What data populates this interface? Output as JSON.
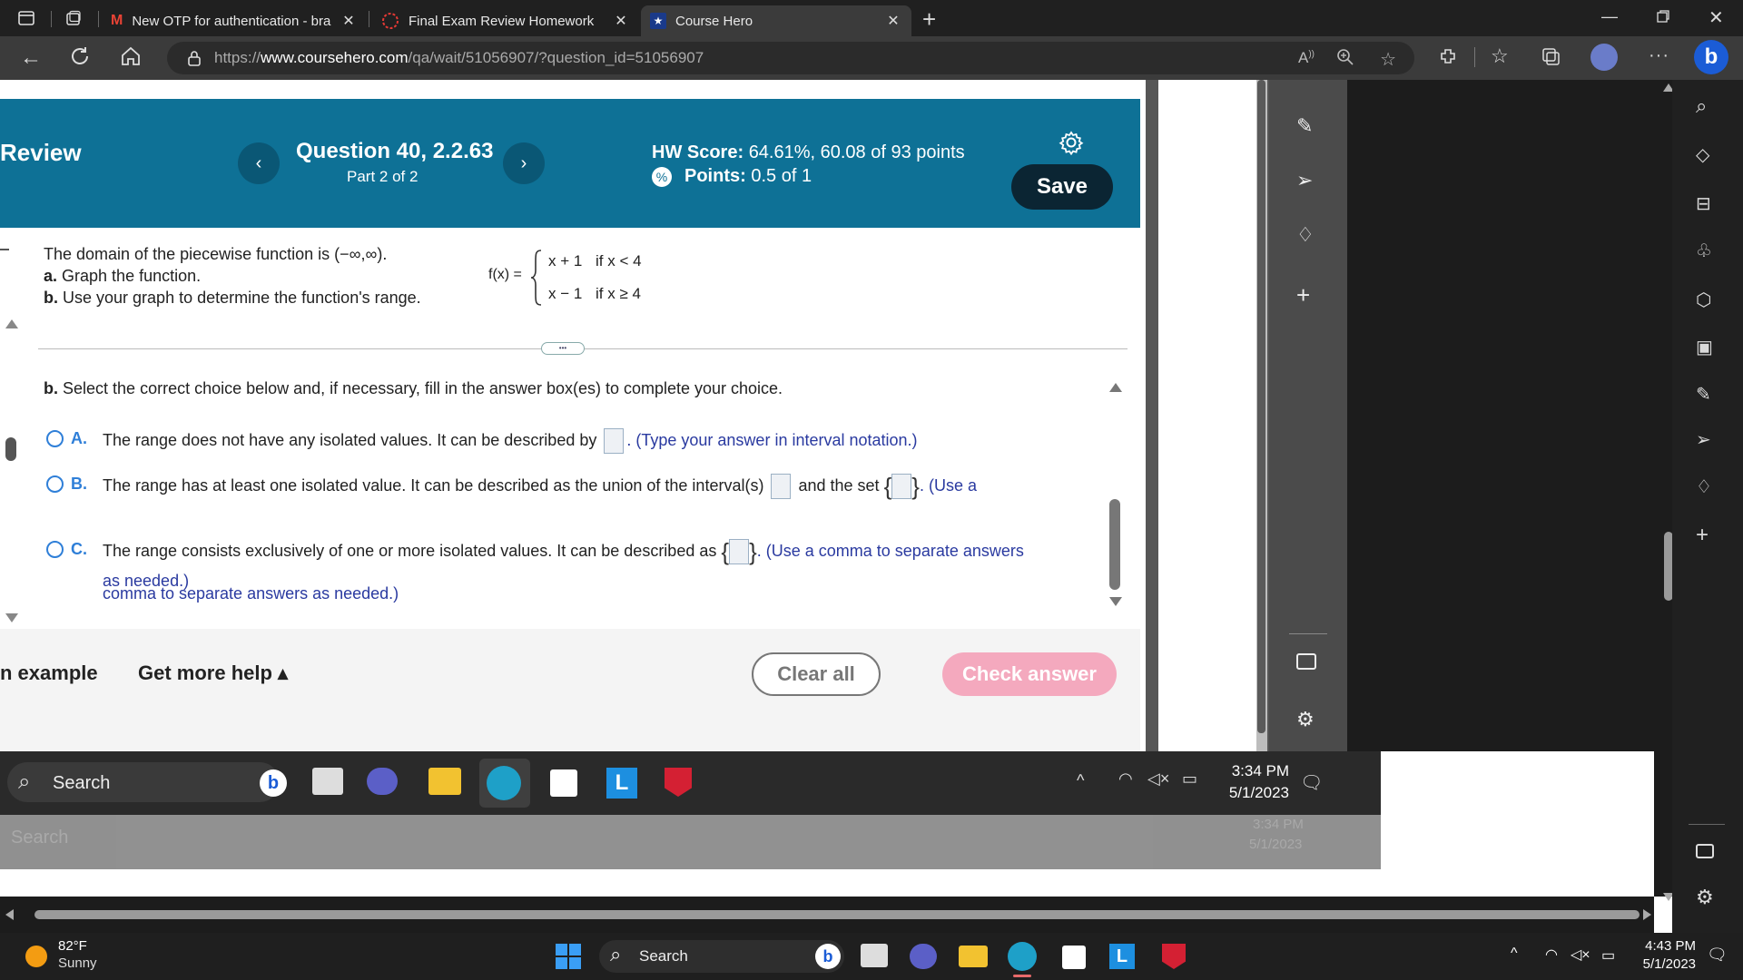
{
  "browser": {
    "tabs": [
      {
        "title": "New OTP for authentication - bra",
        "active": false
      },
      {
        "title": "Final Exam Review Homework",
        "active": false
      },
      {
        "title": "Course Hero",
        "active": true
      }
    ],
    "url": "https://www.coursehero.com/qa/wait/51056907/?question_id=51056907",
    "url_host": "www.coursehero.com",
    "url_rest": "/qa/wait/51056907/?question_id=51056907"
  },
  "header": {
    "review_label": "Review",
    "question_title": "Question 40, 2.2.63",
    "question_part": "Part 2 of 2",
    "hw_score_label": "HW Score:",
    "hw_score_value": "64.61%, 60.08 of 93 points",
    "points_label": "Points:",
    "points_value": "0.5 of 1",
    "save_label": "Save"
  },
  "problem": {
    "intro": "The domain of the piecewise function is (−∞,∞).",
    "part_a_label": "a.",
    "part_a_text": "Graph the function.",
    "part_b_label": "b.",
    "part_b_text": "Use your graph to determine the function's range.",
    "fx_label": "f(x) =",
    "case1_expr": "x + 1",
    "case1_cond": "if  x < 4",
    "case2_expr": "x − 1",
    "case2_cond": "if  x ≥ 4",
    "expand_label": "•••"
  },
  "question": {
    "prompt_label": "b.",
    "prompt_text": "Select the correct choice below and, if necessary, fill in the answer box(es) to complete your choice.",
    "options": [
      {
        "letter": "A.",
        "text": "The range does not have any isolated values. It can be described by",
        "hint": ". (Type your answer in interval notation.)"
      },
      {
        "letter": "B.",
        "text": "The range has at least one isolated value. It can be described as the union of the interval(s)",
        "mid": "and the set",
        "hint": ". (Use a",
        "hint2": "comma to separate answers as needed.)"
      },
      {
        "letter": "C.",
        "text": "The range consists exclusively of one or more isolated values. It can be described as",
        "hint": ". (Use a comma to separate answers",
        "hint2": "as needed.)"
      }
    ]
  },
  "footer": {
    "example_label": "n example",
    "more_help_label": "Get more help ▴",
    "clear_all_label": "Clear all",
    "check_answer_label": "Check answer"
  },
  "inner_taskbar": {
    "search_label": "Search",
    "time": "3:34 PM",
    "date": "5/1/2023",
    "ghost_search": "Search",
    "ghost_time": "3:34 PM",
    "ghost_date": "5/1/2023"
  },
  "taskbar": {
    "weather_temp": "82°F",
    "weather_desc": "Sunny",
    "search_label": "Search",
    "time": "4:43 PM",
    "date": "5/1/2023"
  },
  "colors": {
    "header_bg": "#0e7196",
    "accent_blue": "#2f7fd8",
    "check_answer_bg": "#f4a9be",
    "save_bg": "#0b2533"
  },
  "icons": [
    "sidebar-toggle-icon",
    "tab-actions-icon",
    "gmail-icon",
    "exam-icon",
    "coursehero-icon",
    "new-tab-icon",
    "back-icon",
    "refresh-icon",
    "home-icon",
    "lock-icon",
    "read-aloud-icon",
    "zoom-icon",
    "add-favorite-icon",
    "extensions-icon",
    "favorites-icon",
    "collections-icon",
    "profile-icon",
    "more-icon",
    "bing-icon",
    "gear-icon"
  ]
}
